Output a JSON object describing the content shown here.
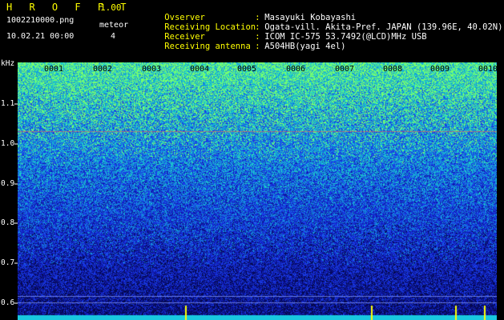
{
  "header": {
    "title": "H R O F F T",
    "version": "1.00",
    "filename": "1002210000.png",
    "meteor_label": "meteor",
    "datetime": "10.02.21 00:00",
    "meteor_count": "4",
    "fields": [
      {
        "key": "Ovserver",
        "value": "Masayuki Kobayashi"
      },
      {
        "key": "Receiving Location",
        "value": "Ogata-vill. Akita-Pref. JAPAN (139.96E, 40.02N)"
      },
      {
        "key": "Receiver",
        "value": "ICOM IC-575 53.7492(@LCD)MHz USB"
      },
      {
        "key": "Receiving antenna",
        "value": "A504HB(yagi 4el)"
      }
    ]
  },
  "spectrogram": {
    "unit": "kHz",
    "y_ticks": [
      "1.1",
      "1.0",
      "0.9",
      "0.8",
      "0.7",
      "0.6"
    ],
    "x_ticks": [
      "0001",
      "0002",
      "0003",
      "0004",
      "0005",
      "0006",
      "0007",
      "0008",
      "0009",
      "0010"
    ],
    "colors": {
      "background": "#000000",
      "deep": "#101890",
      "mid": "#1a3cff",
      "high": "#18c8c8",
      "peak": "#7cff5a",
      "marker": "#ffff00",
      "tick": "#ffffff"
    }
  }
}
